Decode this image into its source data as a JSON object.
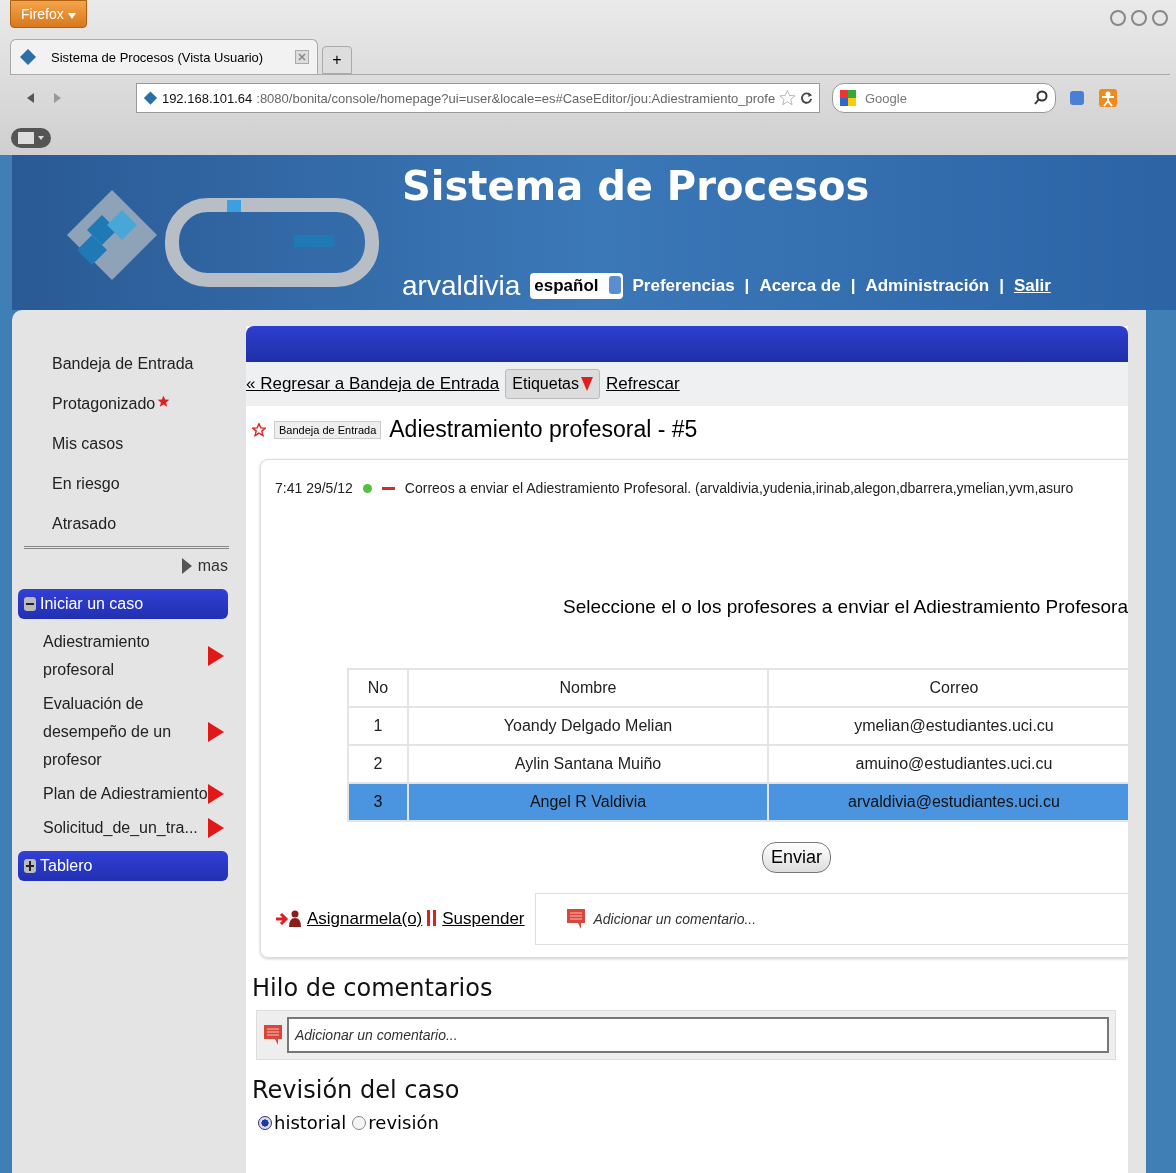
{
  "browser": {
    "menu_button": "Firefox",
    "tab_title": "Sistema de Procesos (Vista Usuario)",
    "new_tab": "+",
    "url_host": "192.168.101.64",
    "url_rest": ":8080/bonita/console/homepage?ui=user&locale=es#CaseEditor/jou:Adiestramiento_profe",
    "search_placeholder": "Google"
  },
  "header": {
    "title": "Sistema de Procesos",
    "user": "arvaldivia",
    "language": "español",
    "links": [
      {
        "label": "Preferencias",
        "underlined": false
      },
      {
        "label": "Acerca de",
        "underlined": false
      },
      {
        "label": "Administración",
        "underlined": false
      },
      {
        "label": "Salir",
        "underlined": true
      }
    ],
    "separator": "|"
  },
  "sidebar": {
    "items": [
      {
        "label": "Bandeja de Entrada",
        "starred": false
      },
      {
        "label": "Protagonizado",
        "starred": true
      },
      {
        "label": "Mis casos",
        "starred": false
      },
      {
        "label": "En riesgo",
        "starred": false
      },
      {
        "label": "Atrasado",
        "starred": false
      }
    ],
    "more": "mas",
    "sections": [
      {
        "label": "Iniciar un caso",
        "expanded": true,
        "items": [
          "Adiestramiento profesoral",
          "Evaluación de desempeño de un profesor",
          "Plan de Adiestramiento",
          "Solicitud_de_un_tra..."
        ]
      },
      {
        "label": "Tablero",
        "expanded": false
      }
    ]
  },
  "case": {
    "back_link": "« Regresar a Bandeja de Entrada",
    "labels_button": "Etiquetas",
    "refresh_link": "Refrescar",
    "starred": false,
    "category": "Bandeja de Entrada",
    "title": "Adiestramiento profesoral - #5",
    "entry": {
      "time": "7:41 29/5/12",
      "color": "#55c040",
      "text": "Correos a enviar el Adiestramiento Profesoral. (arvaldivia,yudenia,irinab,alegon,dbarrera,ymelian,yvm,asuro"
    },
    "form_heading": "Seleccione el o los profesores a enviar el Adiestramiento Profesora",
    "table": {
      "columns": [
        "No",
        "Nombre",
        "Correo"
      ],
      "rows": [
        {
          "cells": [
            "1",
            "Yoandy Delgado Melian",
            "ymelian@estudiantes.uci.cu"
          ],
          "selected": false
        },
        {
          "cells": [
            "2",
            "Aylin Santana Muiño",
            "amuino@estudiantes.uci.cu"
          ],
          "selected": false
        },
        {
          "cells": [
            "3",
            "Angel R Valdivia",
            "arvaldivia@estudiantes.uci.cu"
          ],
          "selected": true
        }
      ]
    },
    "submit": "Enviar",
    "assign_link": "Asignarmela(o)",
    "suspend_link": "Suspender",
    "comment_placeholder": "Adicionar un comentario..."
  },
  "comments": {
    "heading": "Hilo de comentarios",
    "placeholder": "Adicionar un comentario..."
  },
  "review": {
    "heading": "Revisión del caso",
    "options": [
      {
        "label": "historial",
        "selected": true
      },
      {
        "label": "revisión",
        "selected": false
      }
    ]
  }
}
